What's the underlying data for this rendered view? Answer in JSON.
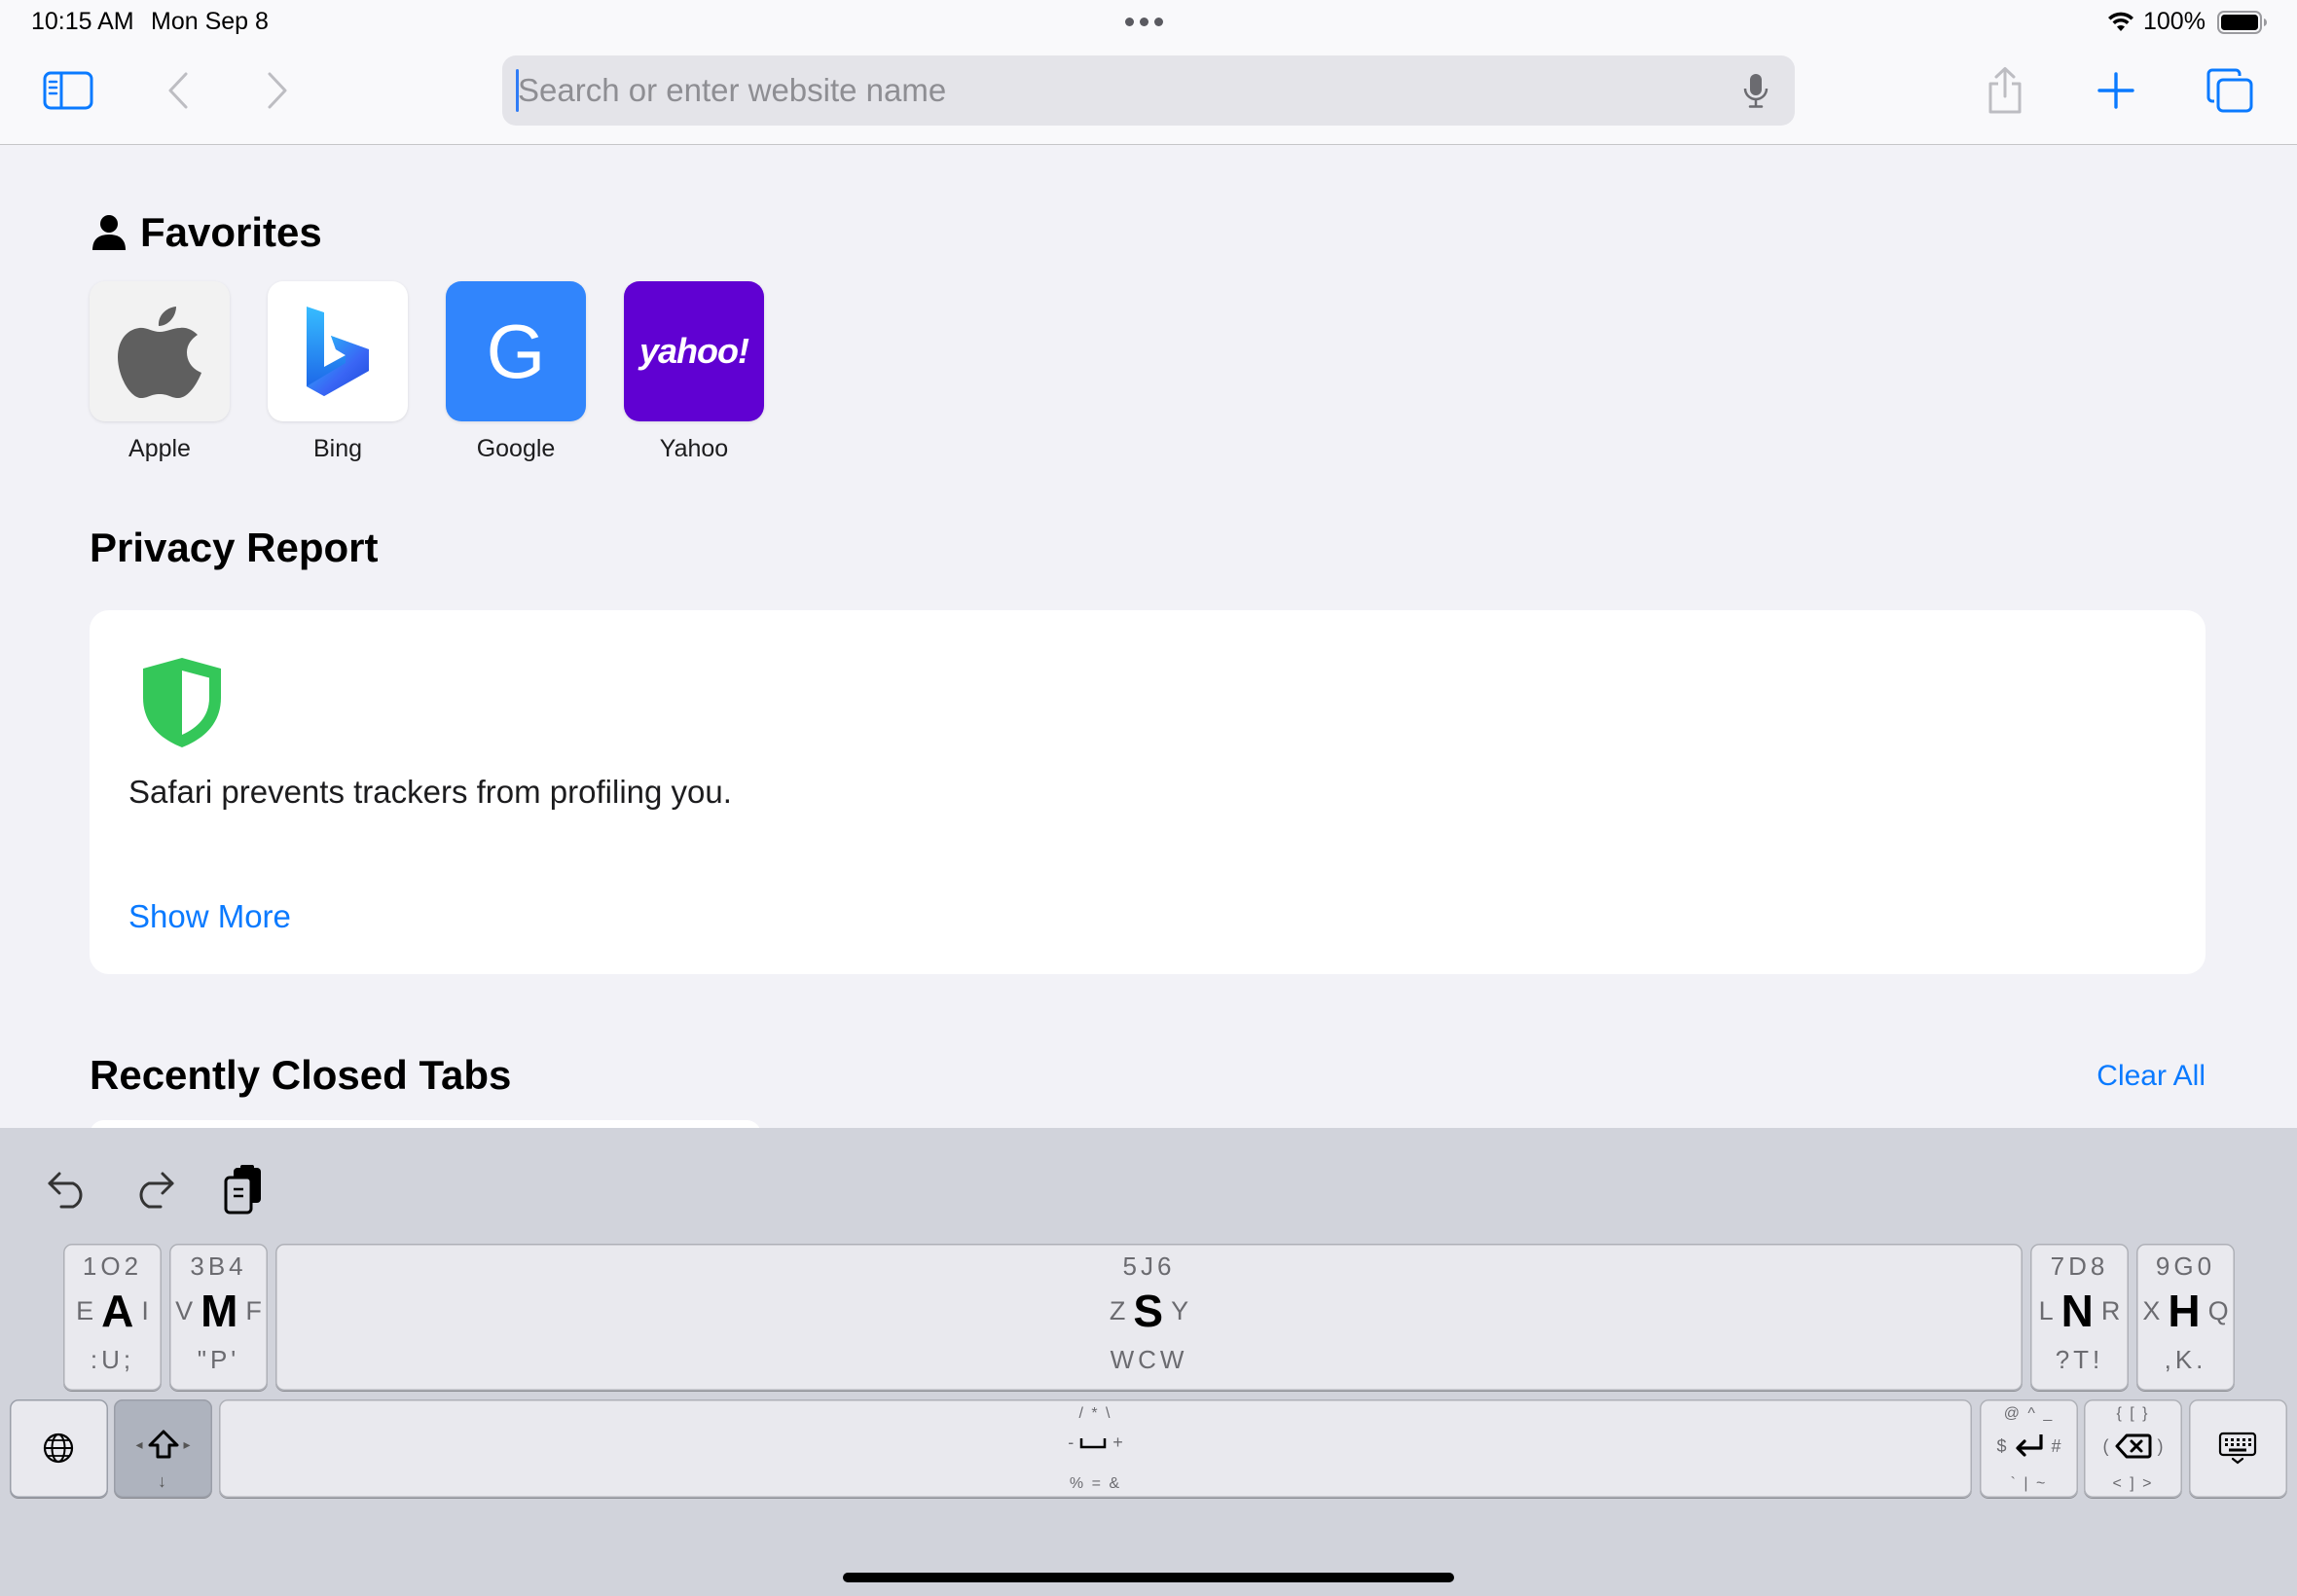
{
  "status_bar": {
    "time": "10:15 AM",
    "date": "Mon Sep 8",
    "battery_percent": "100%",
    "battery_level": 1.0,
    "icons": [
      "multitasking-dots-icon",
      "wifi-icon",
      "battery-icon"
    ]
  },
  "toolbar": {
    "address_placeholder": "Search or enter website name",
    "address_value": "",
    "icons": [
      "sidebar-icon",
      "chevron-left-icon",
      "chevron-right-icon",
      "microphone-icon",
      "share-icon",
      "plus-icon",
      "tabs-overview-icon"
    ]
  },
  "favorites": {
    "heading": "Favorites",
    "items": [
      {
        "label": "Apple",
        "icon": "apple-logo-icon",
        "tile_color": "#f2f2f2"
      },
      {
        "label": "Bing",
        "icon": "bing-logo-icon",
        "tile_color": "#ffffff"
      },
      {
        "label": "Google",
        "icon": "google-letter-icon",
        "letter": "G",
        "tile_color": "#3185fc"
      },
      {
        "label": "Yahoo",
        "icon": "yahoo-wordmark-icon",
        "wordmark": "yahoo!",
        "tile_color": "#6001d2"
      }
    ]
  },
  "privacy_report": {
    "heading": "Privacy Report",
    "message": "Safari prevents trackers from profiling you.",
    "show_more": "Show More",
    "shield_color": "#34c759"
  },
  "recently_closed": {
    "heading": "Recently Closed Tabs",
    "clear_all": "Clear All"
  },
  "keyboard": {
    "toolbar_icons": [
      "undo-icon",
      "redo-icon",
      "paste-icon"
    ],
    "row1": [
      {
        "top": "1O2",
        "left": "E",
        "main": "A",
        "right": "I",
        "bottom": ":U;"
      },
      {
        "top": "3B4",
        "left": "V",
        "main": "M",
        "right": "F",
        "bottom": "\"P'"
      },
      {
        "top": "5J6",
        "left": "Z",
        "main": "S",
        "right": "Y",
        "bottom": "WCW"
      },
      {
        "top": "7D8",
        "left": "L",
        "main": "N",
        "right": "R",
        "bottom": "?T!"
      },
      {
        "top": "9G0",
        "left": "X",
        "main": "H",
        "right": "Q",
        "bottom": ",K."
      }
    ],
    "space": {
      "top": "/ * \\",
      "left": "-",
      "right": "+",
      "bottom": "% = &"
    },
    "return": {
      "top": "@ ^ _",
      "left": "$",
      "right": "#",
      "bottom": "` | ~"
    },
    "delete": {
      "top": "{ [ }",
      "left": "(",
      "right": ")",
      "bottom": "< ] >"
    },
    "shift_bottom": "↓",
    "keys_icons": [
      "globe-icon",
      "shift-icon",
      "return-icon",
      "delete-icon",
      "keyboard-dismiss-icon"
    ]
  },
  "colors": {
    "accent": "#0a7aff",
    "page_bg": "#f2f2f7",
    "keyboard_bg": "#d1d3db"
  }
}
